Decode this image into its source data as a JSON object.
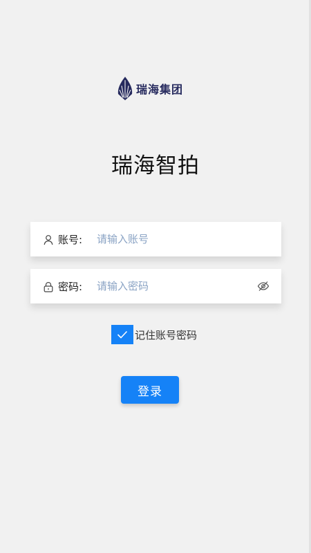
{
  "brand": {
    "logo_text": "瑞海集团",
    "color": "#262a5e"
  },
  "app": {
    "title": "瑞海智拍"
  },
  "username": {
    "label": "账号:",
    "placeholder": "请输入账号",
    "icon": "user-icon"
  },
  "password": {
    "label": "密码:",
    "placeholder": "请输入密码",
    "icon": "lock-icon",
    "toggle_icon": "eye-off-icon"
  },
  "remember": {
    "label": "记住账号密码",
    "checked": true
  },
  "login": {
    "label": "登录"
  },
  "colors": {
    "accent": "#1582f7",
    "background": "#f1f1f1",
    "placeholder": "#8aa3c4"
  }
}
